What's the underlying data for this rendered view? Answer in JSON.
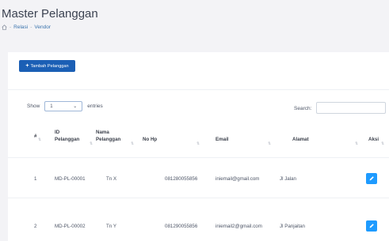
{
  "header": {
    "title": "Master Pelanggan",
    "breadcrumb": [
      "Relasi",
      "Vendor"
    ],
    "breadcrumb_sep": "-"
  },
  "toolbar": {
    "add_label": "Tambah Pelanggan",
    "add_icon": "+"
  },
  "table_controls": {
    "show_label": "Show",
    "entries_value": "1",
    "entries_label": "entries",
    "search_label": "Search:",
    "search_value": ""
  },
  "table": {
    "columns": [
      {
        "label": "#",
        "label2": ""
      },
      {
        "label": "ID",
        "label2": "Pelanggan"
      },
      {
        "label": "Nama",
        "label2": "Pelanggan"
      },
      {
        "label": "No Hp",
        "label2": ""
      },
      {
        "label": "Email",
        "label2": ""
      },
      {
        "label": "Alamat",
        "label2": ""
      },
      {
        "label": "Aksi",
        "label2": ""
      }
    ],
    "rows": [
      {
        "no": "1",
        "id": "MD-PL-00001",
        "nama": "Tn X",
        "hp": "081280055856",
        "email": "iniemail@gmail.com",
        "alamat": "Jl Jalan"
      },
      {
        "no": "2",
        "id": "MD-PL-00002",
        "nama": "Tn Y",
        "hp": "081290055856",
        "email": "iniemail2@gmail.com",
        "alamat": "Jl Panjaitan"
      }
    ]
  },
  "colors": {
    "primary": "#1b5fb5",
    "edit": "#1e9bff",
    "link": "#3b74ad"
  },
  "icons": {
    "home": "home-icon",
    "sort": "sort-icon",
    "edit": "pencil-icon",
    "dropdown": "chevron-down-icon"
  }
}
